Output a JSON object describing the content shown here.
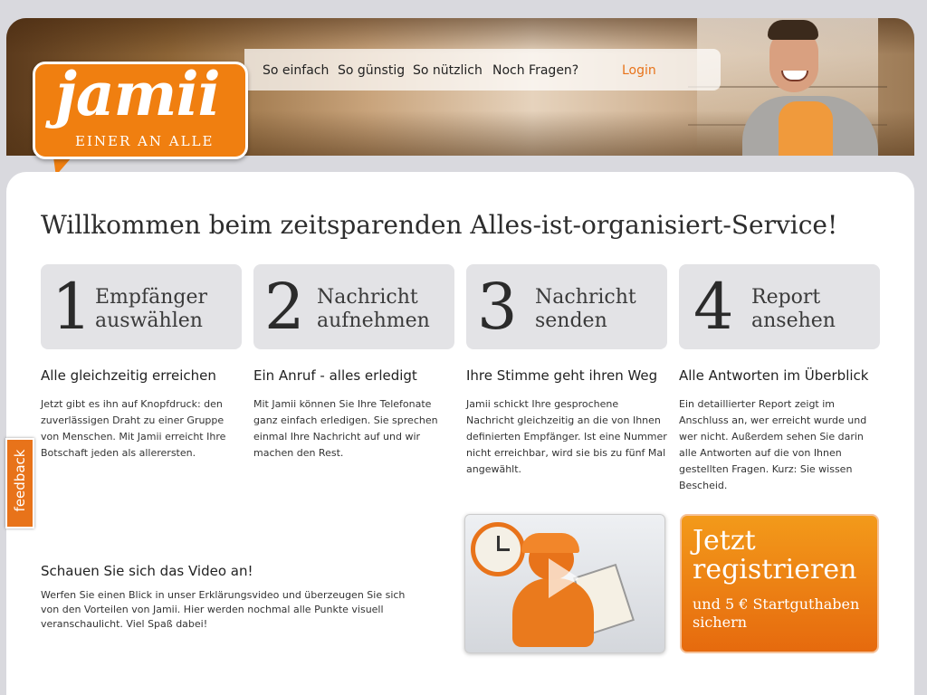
{
  "logo": {
    "word": "jamii",
    "tagline": "EINER AN ALLE"
  },
  "nav": {
    "items": [
      "So einfach",
      "So günstig",
      "So nützlich",
      "Noch Fragen?"
    ],
    "login": "Login"
  },
  "main": {
    "headline": "Willkommen beim zeitsparenden Alles-ist-organisiert-Service!",
    "steps": [
      {
        "number": "1",
        "label": "Empfänger\nauswählen",
        "title": "Alle gleichzeitig erreichen",
        "text": "Jetzt gibt es ihn auf Knopfdruck: den zuverlässigen Draht zu einer Gruppe von Menschen. Mit Jamii erreicht Ihre Botschaft jeden als allerersten."
      },
      {
        "number": "2",
        "label": "Nachricht\naufnehmen",
        "title": "Ein Anruf - alles erledigt",
        "text": "Mit Jamii können Sie Ihre Telefonate ganz einfach erledigen. Sie sprechen einmal Ihre Nachricht auf und wir machen den Rest."
      },
      {
        "number": "3",
        "label": "Nachricht\nsenden",
        "title": "Ihre Stimme geht ihren Weg",
        "text": "Jamii schickt Ihre gesprochene Nachricht gleichzeitig an die von Ihnen definierten Empfänger. Ist eine Nummer nicht erreichbar, wird sie bis zu fünf Mal angewählt."
      },
      {
        "number": "4",
        "label": "Report\nansehen",
        "title": "Alle Antworten im Überblick",
        "text": "Ein detaillierter Report zeigt im Anschluss an, wer erreicht wurde und wer nicht. Außerdem sehen Sie darin alle Antworten auf die von Ihnen gestellten Fragen. Kurz: Sie wissen Bescheid."
      }
    ],
    "video": {
      "title": "Schauen Sie sich das Video an!",
      "text": "Werfen Sie einen Blick in unser Erklärungsvideo und überzeugen Sie sich von den Vorteilen von Jamii. Hier werden nochmal alle Punkte visuell veranschaulicht. Viel Spaß dabei!"
    },
    "cta": {
      "headline": "Jetzt\nregistrieren",
      "subline": "und 5 € Startguthaben sichern"
    }
  },
  "feedback_tab": "feedback",
  "colors": {
    "accent": "#e8731a",
    "step_bg": "#e3e3e6"
  }
}
